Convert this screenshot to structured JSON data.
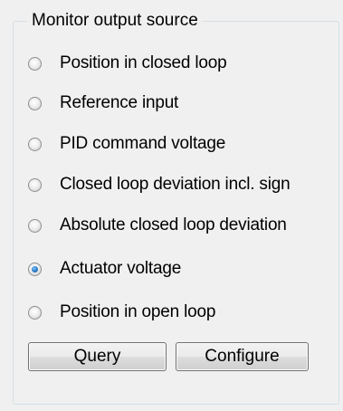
{
  "group": {
    "title": "Monitor output source"
  },
  "options": [
    {
      "label": "Position in closed loop",
      "checked": false
    },
    {
      "label": "Reference input",
      "checked": false
    },
    {
      "label": "PID command voltage",
      "checked": false
    },
    {
      "label": "Closed loop deviation incl. sign",
      "checked": false
    },
    {
      "label": "Absolute closed loop deviation",
      "checked": false
    },
    {
      "label": "Actuator voltage",
      "checked": true
    },
    {
      "label": "Position in open loop",
      "checked": false
    }
  ],
  "buttons": {
    "query": "Query",
    "configure": "Configure"
  },
  "colors": {
    "background": "#f0f0f0",
    "group_border": "#d5dfe5",
    "radio_selected": "#2a79c9"
  }
}
